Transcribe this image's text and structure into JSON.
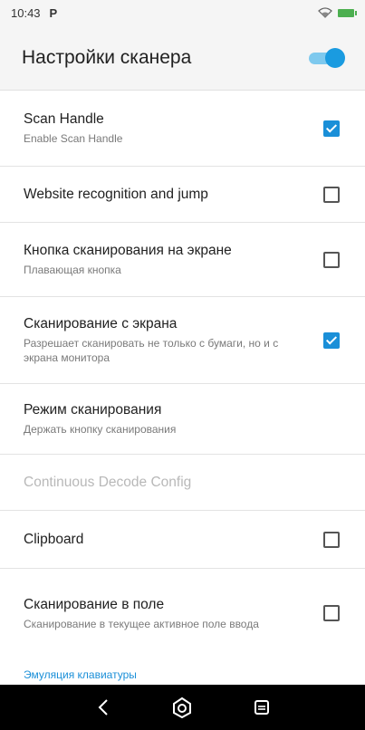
{
  "status": {
    "time": "10:43",
    "notification": "P"
  },
  "app": {
    "title": "Настройки сканера",
    "master_switch_on": true
  },
  "settings": [
    {
      "title": "Scan Handle",
      "subtitle": "Enable Scan Handle",
      "checkbox": "checked"
    },
    {
      "title": "Website recognition and jump",
      "subtitle": "",
      "checkbox": "unchecked"
    },
    {
      "title": "Кнопка сканирования на экране",
      "subtitle": "Плавающая кнопка",
      "checkbox": "unchecked"
    },
    {
      "title": "Сканирование с экрана",
      "subtitle": "Разрешает сканировать не только с бумаги, но и с экрана монитора",
      "checkbox": "checked"
    },
    {
      "title": "Режим сканирования",
      "subtitle": "Держать кнопку сканирования",
      "checkbox": "none"
    },
    {
      "title": "Continuous Decode Config",
      "subtitle": "",
      "checkbox": "none",
      "disabled": true
    },
    {
      "title": "Clipboard",
      "subtitle": "",
      "checkbox": "unchecked"
    },
    {
      "title": "Сканирование в поле",
      "subtitle": "Сканирование в текущее активное поле ввода",
      "checkbox": "unchecked"
    }
  ],
  "section_header": "Эмуляция клавиатуры",
  "nav": {
    "back": "back-icon",
    "home": "home-icon",
    "recents": "recents-icon"
  },
  "colors": {
    "accent": "#1a8fd8",
    "switch_thumb": "#1a9be0",
    "switch_track": "#7ec9ee"
  }
}
